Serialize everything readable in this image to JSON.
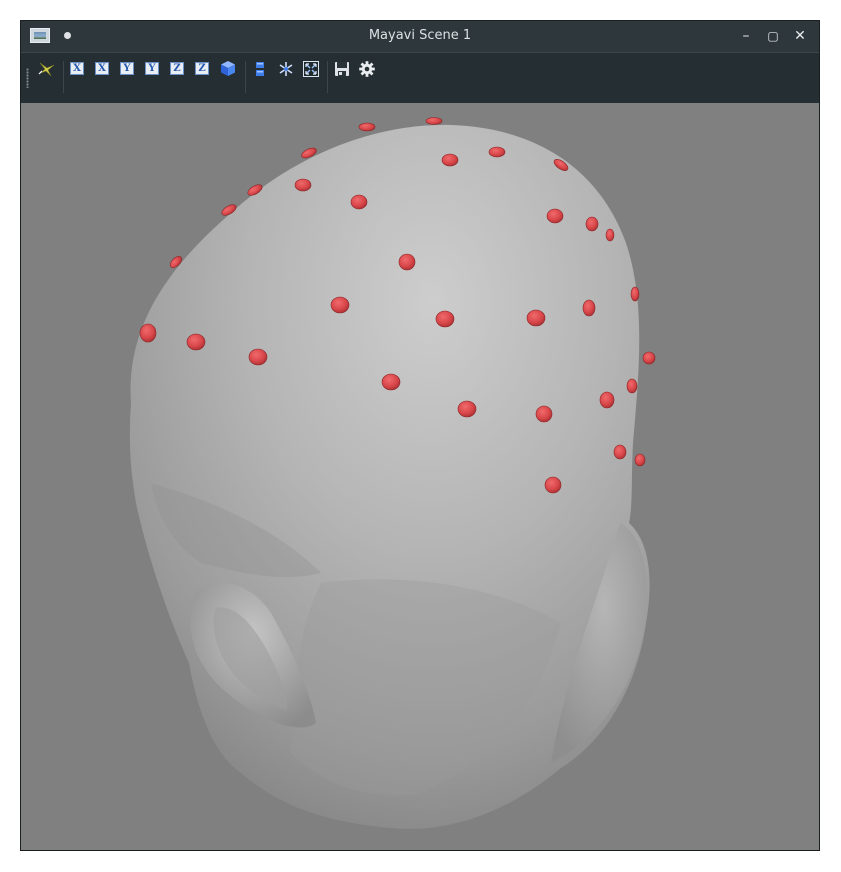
{
  "window": {
    "title": "Mayavi Scene 1"
  },
  "titlebar": {
    "minimize_glyph": "–",
    "maximize_glyph": "▢",
    "close_glyph": "✕"
  },
  "toolbar": {
    "buttons": [
      {
        "name": "parallel-projection-icon"
      },
      {
        "name": "view-x-pos",
        "label": "X"
      },
      {
        "name": "view-x-neg",
        "label": "X"
      },
      {
        "name": "view-y-pos",
        "label": "Y"
      },
      {
        "name": "view-y-neg",
        "label": "Y"
      },
      {
        "name": "view-z-pos",
        "label": "Z"
      },
      {
        "name": "view-z-neg",
        "label": "Z"
      },
      {
        "name": "isometric-view-icon"
      },
      {
        "name": "toggle-axes-icon"
      },
      {
        "name": "full-scene-icon"
      },
      {
        "name": "fullscreen-icon"
      },
      {
        "name": "save-icon"
      },
      {
        "name": "settings-gear-icon"
      }
    ]
  },
  "colors": {
    "background": "#808080",
    "head": "#b8b8b8",
    "electrode": "#d9474a"
  }
}
